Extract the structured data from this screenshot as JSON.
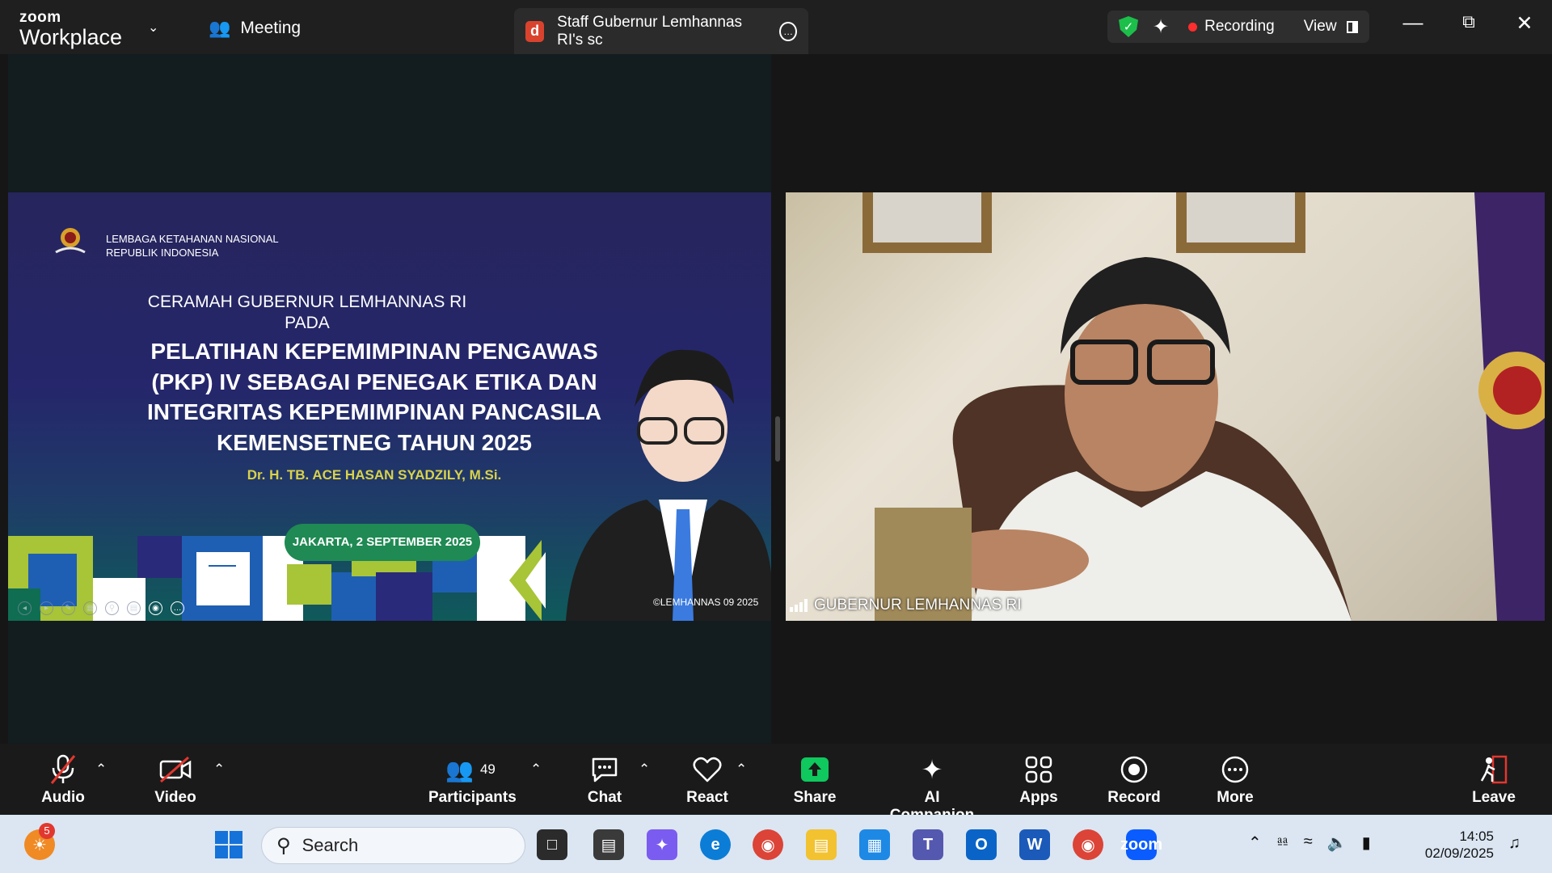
{
  "app": {
    "brand_top": "zoom",
    "brand_bottom": "Workplace"
  },
  "topbar": {
    "meeting_label": "Meeting",
    "share_tab": {
      "initial": "d",
      "title": "Staff Gubernur Lemhannas RI's sc"
    },
    "recording_label": "Recording",
    "view_label": "View",
    "colors": {
      "shield": "#1bbf4a",
      "recording_dot": "#ff2d2d"
    }
  },
  "slide": {
    "org_line1": "LEMBAGA KETAHANAN NASIONAL",
    "org_line2": "REPUBLIK INDONESIA",
    "subtitle_line1": "CERAMAH GUBERNUR LEMHANNAS RI",
    "subtitle_line2": "PADA",
    "title": "PELATIHAN KEPEMIMPINAN PENGAWAS (PKP) IV SEBAGAI PENEGAK ETIKA DAN INTEGRITAS KEPEMIMPINAN PANCASILA KEMENSETNEG TAHUN 2025",
    "speaker": "Dr. H. TB. ACE HASAN SYADZILY, M.Si.",
    "date": "JAKARTA, 2 SEPTEMBER 2025",
    "copyright": "©LEMHANNAS 09 2025",
    "colors": {
      "speaker": "#d9d24a",
      "date_pill": "#1f8a53"
    }
  },
  "video": {
    "participant_name": "GUBERNUR LEMHANNAS RI"
  },
  "toolbar": {
    "audio": "Audio",
    "video": "Video",
    "participants": "Participants",
    "participants_count": "49",
    "chat": "Chat",
    "react": "React",
    "share": "Share",
    "ai_companion": "AI Companion",
    "apps": "Apps",
    "record": "Record",
    "more": "More",
    "leave": "Leave",
    "colors": {
      "share": "#0fc85e",
      "leave": "#e2372f",
      "muted_slash": "#e2372f"
    }
  },
  "taskbar": {
    "notification_count": "5",
    "search_placeholder": "Search",
    "time": "14:05",
    "date": "02/09/2025"
  }
}
